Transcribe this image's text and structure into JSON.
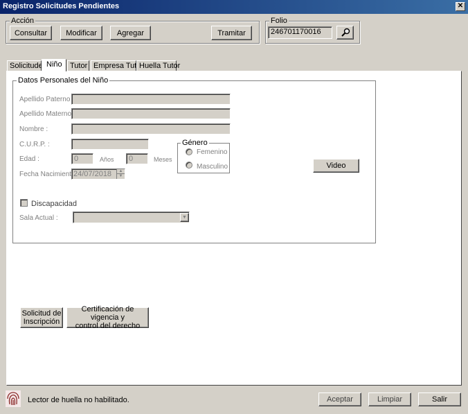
{
  "window": {
    "title": "Registro Solicitudes Pendientes",
    "close_glyph": "✕"
  },
  "accion": {
    "legend": "Acción",
    "consultar": "Consultar",
    "modificar": "Modificar",
    "agregar": "Agregar",
    "tramitar": "Tramitar"
  },
  "folio": {
    "legend": "Folio",
    "value": "246701170016",
    "search_icon": "magnifier-icon"
  },
  "tabs": [
    {
      "label": "Solicitudes"
    },
    {
      "label": "Niño"
    },
    {
      "label": "Tutor"
    },
    {
      "label": "Empresa Tutor"
    },
    {
      "label": "Huella Tutor"
    }
  ],
  "datos": {
    "legend": "Datos Personales del Niño",
    "apellido_paterno_label": "Apellido Paterno :",
    "apellido_materno_label": "Apellido Materno :",
    "nombre_label": "Nombre :",
    "curp_label": "C.U.R.P. :",
    "edad_label": "Edad :",
    "edad_anios_value": "0",
    "anios_label": "Años",
    "edad_meses_value": "0",
    "meses_label": "Meses",
    "fecha_label": "Fecha Nacimiento :",
    "fecha_value": "24/07/2018",
    "genero_legend": "Género",
    "femenino": "Femenino",
    "masculino": "Masculino",
    "video": "Video",
    "discapacidad": "Discapacidad",
    "sala_label": "Sala Actual :",
    "sala_value": ""
  },
  "docs": {
    "solicitud_line1": "Solicitud de",
    "solicitud_line2": "Inscripción",
    "cert_line1": "Certificación de vigencia y",
    "cert_line2": "control del derecho"
  },
  "footer": {
    "status": "Lector de huella no habilitado.",
    "aceptar": "Aceptar",
    "limpiar": "Limpiar",
    "salir": "Salir",
    "fingerprint_icon": "fingerprint-icon"
  }
}
